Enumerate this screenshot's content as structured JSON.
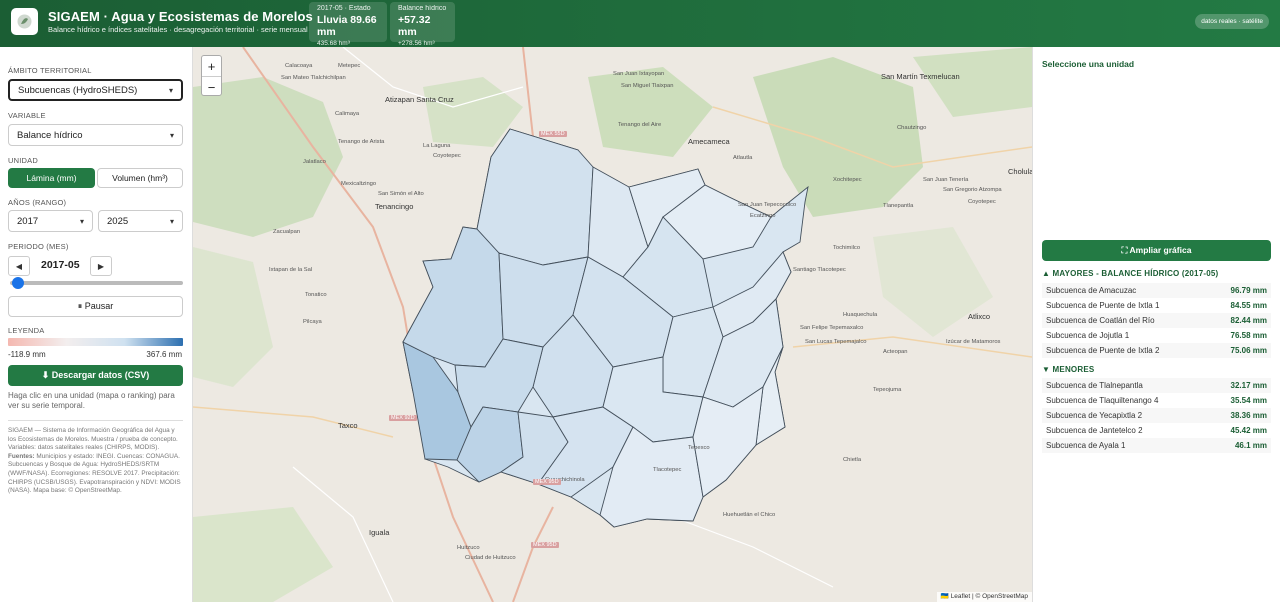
{
  "header": {
    "title": "SIGAEM · Agua y Ecosistemas de Morelos",
    "subtitle": "Balance hídrico e índices satelitales · desagregación territorial · serie mensual",
    "kpi_rain": {
      "label": "2017-05 · Estado",
      "value": "Lluvia 89.66 mm",
      "sub": "435.68 hm³"
    },
    "kpi_balance": {
      "label": "Balance hídrico",
      "value": "+57.32 mm",
      "sub": "+278.56 hm³"
    },
    "badge": "datos reales · satélite"
  },
  "sidebar": {
    "territory_label": "ÁMBITO TERRITORIAL",
    "territory_value": "Subcuencas (HydroSHEDS)",
    "variable_label": "VARIABLE",
    "variable_value": "Balance hídrico",
    "unit_label": "UNIDAD",
    "unit_lamina": "Lámina (mm)",
    "unit_volumen": "Volumen (hm³)",
    "years_label": "AÑOS (RANGO)",
    "year_from": "2017",
    "year_to": "2025",
    "period_label": "PERIODO (MES)",
    "period_value": "2017-05",
    "slider_fraction": 0.0,
    "pause_label": "⏸ Pausar",
    "legend_label": "LEYENDA",
    "legend_min": "-118.9 mm",
    "legend_max": "367.6 mm",
    "download_label": "⬇ Descargar datos (CSV)",
    "hint": "Haga clic en una unidad (mapa o ranking) para ver su serie temporal.",
    "about": "SIGAEM — Sistema de Información Geográfica del Agua y los Ecosistemas de Morelos. Muestra / prueba de concepto.",
    "variables_note": "Variables: datos satelitales reales (CHIRPS, MODIS).",
    "sources_label": "Fuentes:",
    "sources": "Municipios y estado: INEGI. Cuencas: CONAGUA. Subcuencas y Bosque de Agua: HydroSHEDS/SRTM (WWF/NASA). Ecorregiones: RESOLVE 2017. Precipitación: CHIRPS (UCSB/USGS). Evapotranspiración y NDVI: MODIS (NASA). Mapa base: © OpenStreetMap."
  },
  "map": {
    "zoom_in": "+",
    "zoom_out": "−",
    "attribution": "🇺🇦 Leaflet | © OpenStreetMap",
    "place_labels": [
      "Calacoaya",
      "Metepec",
      "San Mateo Tlalchichilpan",
      "Atizapan Santa Cruz",
      "Calimaya",
      "Tenango de Arista",
      "Jalatlaco",
      "La Laguna",
      "Coyotepec",
      "Mexicaltzingo",
      "San Simón el Alto",
      "Tenancingo",
      "San Juan Tepecoculco",
      "Ecatzingo",
      "Tochimilco",
      "Atlixco",
      "Zacualpan",
      "Ixtapan de la Sal",
      "Tonatico",
      "Pilcaya",
      "Taxco",
      "Iguala",
      "Huitzuco",
      "Ciudad de Huitzuco",
      "Cuauchichinola",
      "Huehuetlán el Chico",
      "Tepexco",
      "Tlacotepec",
      "Chietla",
      "Tepeojuma",
      "San Juan Ixtayopan",
      "San Miguel Tlaixpan",
      "Amecameca",
      "Tenango del Aire",
      "Atlautla",
      "Santiago Tlacotepec",
      "San Martín Texmelucan",
      "Cholula",
      "Huaquechula",
      "San Felipe Tepemaxalco",
      "San Lucas Tepemajalco",
      "Acteopan",
      "Izúcar de Matamoros",
      "Xochitepec",
      "San Juan Tenería",
      "San Gregorio Atzompa",
      "Coyotepec",
      "Tlanepantla",
      "Chautzingo"
    ],
    "highway_labels": [
      "MEX 55D",
      "MEX 95D",
      "MEX 95D",
      "MEX 92D"
    ]
  },
  "right_panel": {
    "title": "Seleccione una unidad",
    "expand_label": "⛶ Ampliar gráfica",
    "top_title": "▲ MAYORES - BALANCE HÍDRICO (2017-05)",
    "top": [
      {
        "name": "Subcuenca de Amacuzac",
        "value": "96.79 mm"
      },
      {
        "name": "Subcuenca de Puente de Ixtla 1",
        "value": "84.55 mm"
      },
      {
        "name": "Subcuenca de Coatlán del Río",
        "value": "82.44 mm"
      },
      {
        "name": "Subcuenca de Jojutla 1",
        "value": "76.58 mm"
      },
      {
        "name": "Subcuenca de Puente de Ixtla 2",
        "value": "75.06 mm"
      }
    ],
    "bottom_title": "▼ MENORES",
    "bottom": [
      {
        "name": "Subcuenca de Tlalnepantla",
        "value": "32.17 mm"
      },
      {
        "name": "Subcuenca de Tlaquiltenango 4",
        "value": "35.54 mm"
      },
      {
        "name": "Subcuenca de Yecapixtla 2",
        "value": "38.36 mm"
      },
      {
        "name": "Subcuenca de Jantetelco 2",
        "value": "45.42 mm"
      },
      {
        "name": "Subcuenca de Ayala 1",
        "value": "46.1 mm"
      }
    ]
  }
}
